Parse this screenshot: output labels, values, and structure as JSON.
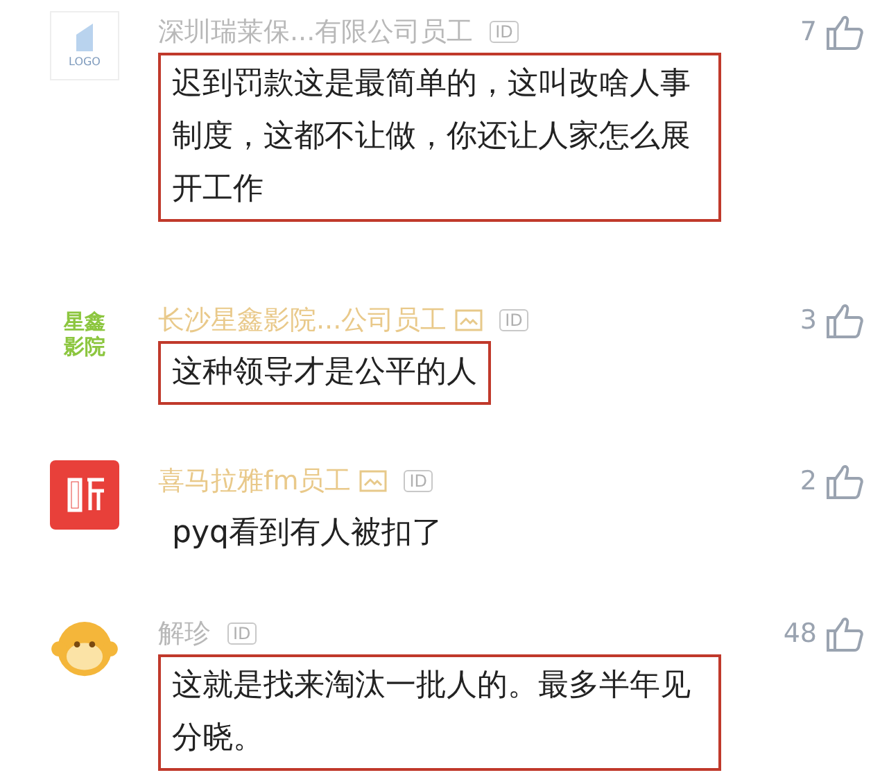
{
  "comments": [
    {
      "avatar": {
        "kind": "logo",
        "text": "LOGO"
      },
      "name": "深圳瑞莱保...有限公司员工",
      "vip": false,
      "card_badge": false,
      "id_badge": "ID",
      "likes": "7",
      "text": "迟到罚款这是最简单的，这叫改啥人事制度，这都不让做，你还让人家怎么展开工作",
      "highlighted": true
    },
    {
      "avatar": {
        "kind": "wordmark",
        "text": "星鑫影院"
      },
      "name": "长沙星鑫影院...公司员工",
      "vip": true,
      "card_badge": true,
      "id_badge": "ID",
      "likes": "3",
      "text": "这种领导才是公平的人",
      "highlighted": true
    },
    {
      "avatar": {
        "kind": "app"
      },
      "name": "喜马拉雅fm员工",
      "vip": true,
      "card_badge": true,
      "id_badge": "ID",
      "likes": "2",
      "text": "pyq看到有人被扣了",
      "highlighted": false
    },
    {
      "avatar": {
        "kind": "monkey"
      },
      "name": "解珍",
      "vip": false,
      "card_badge": false,
      "id_badge": "ID",
      "likes": "48",
      "text": "这就是找来淘汰一批人的。最多半年见分晓。",
      "highlighted": true
    }
  ]
}
